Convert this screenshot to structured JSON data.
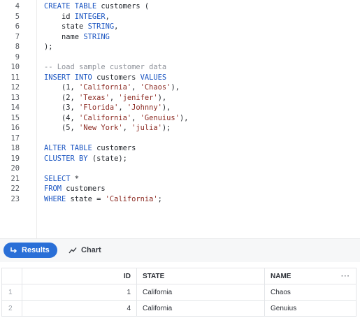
{
  "editor": {
    "lines": [
      {
        "n": "4",
        "tokens": [
          {
            "t": "CREATE TABLE ",
            "c": "kw"
          },
          {
            "t": "customers (",
            "c": "plain"
          }
        ]
      },
      {
        "n": "5",
        "tokens": [
          {
            "t": "    id ",
            "c": "plain"
          },
          {
            "t": "INTEGER",
            "c": "kw"
          },
          {
            "t": ",",
            "c": "plain"
          }
        ]
      },
      {
        "n": "6",
        "tokens": [
          {
            "t": "    state ",
            "c": "plain"
          },
          {
            "t": "STRING",
            "c": "kw"
          },
          {
            "t": ",",
            "c": "plain"
          }
        ]
      },
      {
        "n": "7",
        "tokens": [
          {
            "t": "    name ",
            "c": "plain"
          },
          {
            "t": "STRING",
            "c": "kw"
          }
        ]
      },
      {
        "n": "8",
        "tokens": [
          {
            "t": ");",
            "c": "plain"
          }
        ]
      },
      {
        "n": "9",
        "tokens": []
      },
      {
        "n": "10",
        "tokens": [
          {
            "t": "-- Load sample customer data",
            "c": "cmt"
          }
        ]
      },
      {
        "n": "11",
        "tokens": [
          {
            "t": "INSERT INTO ",
            "c": "kw"
          },
          {
            "t": "customers ",
            "c": "plain"
          },
          {
            "t": "VALUES",
            "c": "kw"
          }
        ]
      },
      {
        "n": "12",
        "tokens": [
          {
            "t": "    (1, ",
            "c": "plain"
          },
          {
            "t": "'California'",
            "c": "str"
          },
          {
            "t": ", ",
            "c": "plain"
          },
          {
            "t": "'Chaos'",
            "c": "str"
          },
          {
            "t": "),",
            "c": "plain"
          }
        ]
      },
      {
        "n": "13",
        "tokens": [
          {
            "t": "    (2, ",
            "c": "plain"
          },
          {
            "t": "'Texas'",
            "c": "str"
          },
          {
            "t": ", ",
            "c": "plain"
          },
          {
            "t": "'jenifer'",
            "c": "str"
          },
          {
            "t": "),",
            "c": "plain"
          }
        ]
      },
      {
        "n": "14",
        "tokens": [
          {
            "t": "    (3, ",
            "c": "plain"
          },
          {
            "t": "'Florida'",
            "c": "str"
          },
          {
            "t": ", ",
            "c": "plain"
          },
          {
            "t": "'Johnny'",
            "c": "str"
          },
          {
            "t": "),",
            "c": "plain"
          }
        ]
      },
      {
        "n": "15",
        "tokens": [
          {
            "t": "    (4, ",
            "c": "plain"
          },
          {
            "t": "'California'",
            "c": "str"
          },
          {
            "t": ", ",
            "c": "plain"
          },
          {
            "t": "'Genuius'",
            "c": "str"
          },
          {
            "t": "),",
            "c": "plain"
          }
        ]
      },
      {
        "n": "16",
        "tokens": [
          {
            "t": "    (5, ",
            "c": "plain"
          },
          {
            "t": "'New York'",
            "c": "str"
          },
          {
            "t": ", ",
            "c": "plain"
          },
          {
            "t": "'julia'",
            "c": "str"
          },
          {
            "t": ");",
            "c": "plain"
          }
        ]
      },
      {
        "n": "17",
        "tokens": []
      },
      {
        "n": "18",
        "tokens": [
          {
            "t": "ALTER TABLE ",
            "c": "kw"
          },
          {
            "t": "customers",
            "c": "plain"
          }
        ]
      },
      {
        "n": "19",
        "tokens": [
          {
            "t": "CLUSTER BY ",
            "c": "kw"
          },
          {
            "t": "(state);",
            "c": "plain"
          }
        ]
      },
      {
        "n": "20",
        "tokens": []
      },
      {
        "n": "21",
        "tokens": [
          {
            "t": "SELECT ",
            "c": "kw"
          },
          {
            "t": "*",
            "c": "plain"
          }
        ]
      },
      {
        "n": "22",
        "tokens": [
          {
            "t": "FROM ",
            "c": "kw"
          },
          {
            "t": "customers",
            "c": "plain"
          }
        ]
      },
      {
        "n": "23",
        "tokens": [
          {
            "t": "WHERE ",
            "c": "kw"
          },
          {
            "t": "state = ",
            "c": "plain"
          },
          {
            "t": "'California'",
            "c": "str"
          },
          {
            "t": ";",
            "c": "plain"
          }
        ]
      }
    ]
  },
  "tabs": {
    "results_label": "Results",
    "results_icon": "arrow-return-icon",
    "chart_label": "Chart",
    "chart_icon": "line-chart-icon"
  },
  "results": {
    "columns": {
      "id": "ID",
      "state": "STATE",
      "name": "NAME"
    },
    "rows": [
      {
        "row": "1",
        "id": "1",
        "state": "California",
        "name": "Chaos"
      },
      {
        "row": "2",
        "id": "4",
        "state": "California",
        "name": "Genuius"
      }
    ],
    "column_menu": "···"
  },
  "colors": {
    "accent": "#2a6fd7",
    "keyword": "#1c56c2",
    "string": "#8c2b23",
    "comment": "#8d9199"
  }
}
